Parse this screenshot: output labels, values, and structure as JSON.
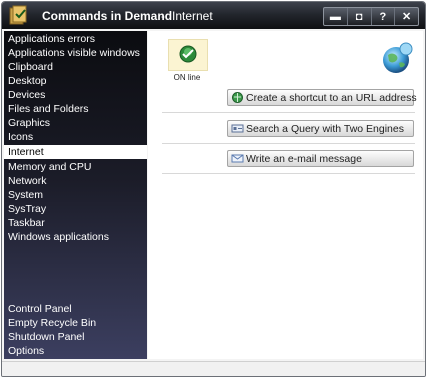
{
  "window": {
    "title": "Commands in Demand",
    "separator": "-",
    "section": "Internet",
    "controls": {
      "minimize": "▬",
      "restore": "◘",
      "help": "?",
      "close": "✕"
    }
  },
  "sidebar": {
    "categories": [
      "Applications errors",
      "Applications visible windows",
      "Clipboard",
      "Desktop",
      "Devices",
      "Files and Folders",
      "Graphics",
      "Icons",
      "Internet",
      "Memory and CPU",
      "Network",
      "System",
      "SysTray",
      "Taskbar",
      "Windows applications"
    ],
    "selected_category": "Internet",
    "bottom": [
      "Control Panel",
      "Empty Recycle Bin",
      "Shutdown Panel",
      "Options"
    ]
  },
  "main": {
    "status_label": "ON line",
    "actions": [
      {
        "label": "Create a shortcut to an URL address",
        "icon": "url-shortcut-icon"
      },
      {
        "label": "Search a Query with Two Engines",
        "icon": "search-engines-icon"
      },
      {
        "label": "Write an e-mail message",
        "icon": "envelope-icon"
      }
    ]
  },
  "colors": {
    "accent": "#2c8a3a",
    "sidebar_dark": "#0b0c10",
    "selected_bg": "#ffffff"
  }
}
